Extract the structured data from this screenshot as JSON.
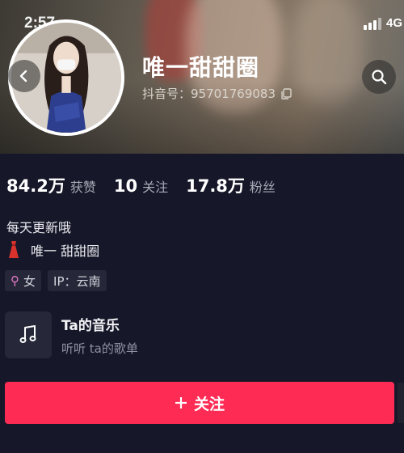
{
  "status_bar": {
    "time": "2:57",
    "network": "4G"
  },
  "profile": {
    "name": "唯一甜甜圈",
    "douyin_id_label": "抖音号：",
    "douyin_id": "95701769083"
  },
  "stats": [
    {
      "value": "84.2万",
      "label": "获赞"
    },
    {
      "value": "10",
      "label": "关注"
    },
    {
      "value": "17.8万",
      "label": "粉丝"
    }
  ],
  "bio": {
    "line1": "每天更新哦",
    "line2": "唯一 甜甜圈"
  },
  "tags": {
    "gender": "女",
    "ip": "IP：云南"
  },
  "music": {
    "title": "Ta的音乐",
    "subtitle": "听听 ta的歌单"
  },
  "follow_button": {
    "label": "关注"
  },
  "icons": {
    "back": "chevron-left-icon",
    "search": "search-icon",
    "copy": "copy-icon",
    "dress": "dress-icon",
    "gender": "female-symbol-icon",
    "music": "music-note-icon",
    "plus": "plus-icon"
  },
  "colors": {
    "background": "#16182a",
    "accent": "#fe2c55",
    "tag_bg": "#262839",
    "secondary_text": "#a8aab6"
  }
}
